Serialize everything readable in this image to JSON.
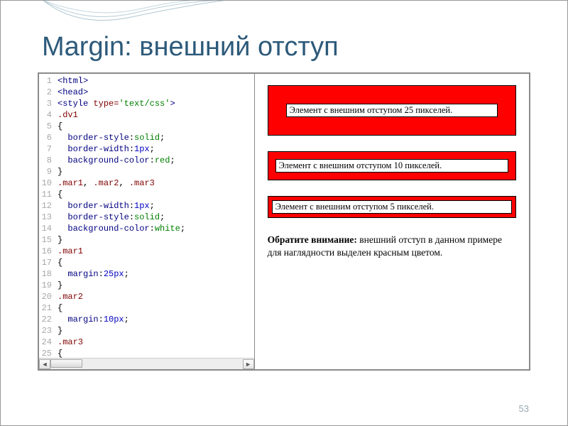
{
  "title": "Margin: внешний отступ",
  "code": {
    "lines": [
      {
        "n": 1,
        "html": "<span class='tag'>&lt;html&gt;</span>"
      },
      {
        "n": 2,
        "html": "<span class='tag'>&lt;head&gt;</span>"
      },
      {
        "n": 3,
        "html": "<span class='tag'>&lt;style</span> <span class='attr'>type=</span><span class='str'>'text/css'</span><span class='tag'>&gt;</span>"
      },
      {
        "n": 4,
        "html": "<span class='sel'>.dv1</span>"
      },
      {
        "n": 5,
        "html": "{"
      },
      {
        "n": 6,
        "html": "  <span class='prop'>border-style</span>:<span class='val'>solid</span>;"
      },
      {
        "n": 7,
        "html": "  <span class='prop'>border-width</span>:<span class='num'>1px</span>;"
      },
      {
        "n": 8,
        "html": "  <span class='prop'>background-color</span>:<span class='val'>red</span>;"
      },
      {
        "n": 9,
        "html": "}"
      },
      {
        "n": 10,
        "html": "<span class='sel'>.mar1</span>, <span class='sel'>.mar2</span>, <span class='sel'>.mar3</span>"
      },
      {
        "n": 11,
        "html": "{"
      },
      {
        "n": 12,
        "html": "  <span class='prop'>border-width</span>:<span class='num'>1px</span>;"
      },
      {
        "n": 13,
        "html": "  <span class='prop'>border-style</span>:<span class='val'>solid</span>;"
      },
      {
        "n": 14,
        "html": "  <span class='prop'>background-color</span>:<span class='val'>white</span>;"
      },
      {
        "n": 15,
        "html": "}"
      },
      {
        "n": 16,
        "html": "<span class='sel'>.mar1</span>"
      },
      {
        "n": 17,
        "html": "{"
      },
      {
        "n": 18,
        "html": "  <span class='prop'>margin</span>:<span class='num'>25px</span>;"
      },
      {
        "n": 19,
        "html": "}"
      },
      {
        "n": 20,
        "html": "<span class='sel'>.mar2</span>"
      },
      {
        "n": 21,
        "html": "{"
      },
      {
        "n": 22,
        "html": "  <span class='prop'>margin</span>:<span class='num'>10px</span>;"
      },
      {
        "n": 23,
        "html": "}"
      },
      {
        "n": 24,
        "html": "<span class='sel'>.mar3</span>"
      },
      {
        "n": 25,
        "html": "{"
      }
    ]
  },
  "preview": {
    "box25": "Элемент с внешним отступом 25 пикселей.",
    "box10": "Элемент с внешним отступом 10 пикселей.",
    "box5": "Элемент с внешним отступом 5 пикселей.",
    "note_bold": "Обратите внимание:",
    "note_rest": " внешний отступ в данном примере для наглядности выделен красным цветом."
  },
  "page_number": "53"
}
